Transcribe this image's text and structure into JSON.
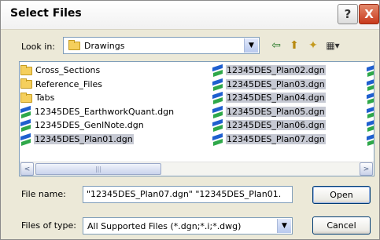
{
  "window": {
    "title": "Select Files",
    "help_label": "?",
    "close_label": "X"
  },
  "lookin": {
    "label": "Look in:",
    "value": "Drawings"
  },
  "toolbar": {
    "back_glyph": "⇦",
    "up_glyph": "⬆",
    "new_folder_glyph": "✦",
    "views_glyph": "▦▾"
  },
  "files": [
    {
      "name": "Cross_Sections",
      "type": "folder",
      "selected": false
    },
    {
      "name": "Reference_Files",
      "type": "folder",
      "selected": false
    },
    {
      "name": "Tabs",
      "type": "folder",
      "selected": false
    },
    {
      "name": "12345DES_EarthworkQuant.dgn",
      "type": "dgn",
      "selected": false
    },
    {
      "name": "12345DES_GenlNote.dgn",
      "type": "dgn",
      "selected": false
    },
    {
      "name": "12345DES_Plan01.dgn",
      "type": "dgn",
      "selected": true
    },
    {
      "name": "12345DES_Plan02.dgn",
      "type": "dgn",
      "selected": true
    },
    {
      "name": "12345DES_Plan03.dgn",
      "type": "dgn",
      "selected": true
    },
    {
      "name": "12345DES_Plan04.dgn",
      "type": "dgn",
      "selected": true
    },
    {
      "name": "12345DES_Plan05.dgn",
      "type": "dgn",
      "selected": true
    },
    {
      "name": "12345DES_Plan06.dgn",
      "type": "dgn",
      "selected": true
    },
    {
      "name": "12345DES_Plan07.dgn",
      "type": "dgn",
      "selected": true
    }
  ],
  "scroll": {
    "left_glyph": "<",
    "right_glyph": ">",
    "thumb_glyph": "|||"
  },
  "filename": {
    "label": "File name:",
    "value": "\"12345DES_Plan07.dgn\" \"12345DES_Plan01."
  },
  "filetype": {
    "label": "Files of type:",
    "value": "All Supported Files (*.dgn;*.i;*.dwg)"
  },
  "buttons": {
    "open": "Open",
    "cancel": "Cancel"
  },
  "colors": {
    "selection": "#c6c9d3",
    "dialog_bg": "#ece9d8",
    "dgn_blue": "#1f5fcf",
    "dgn_green": "#2fa84a"
  }
}
